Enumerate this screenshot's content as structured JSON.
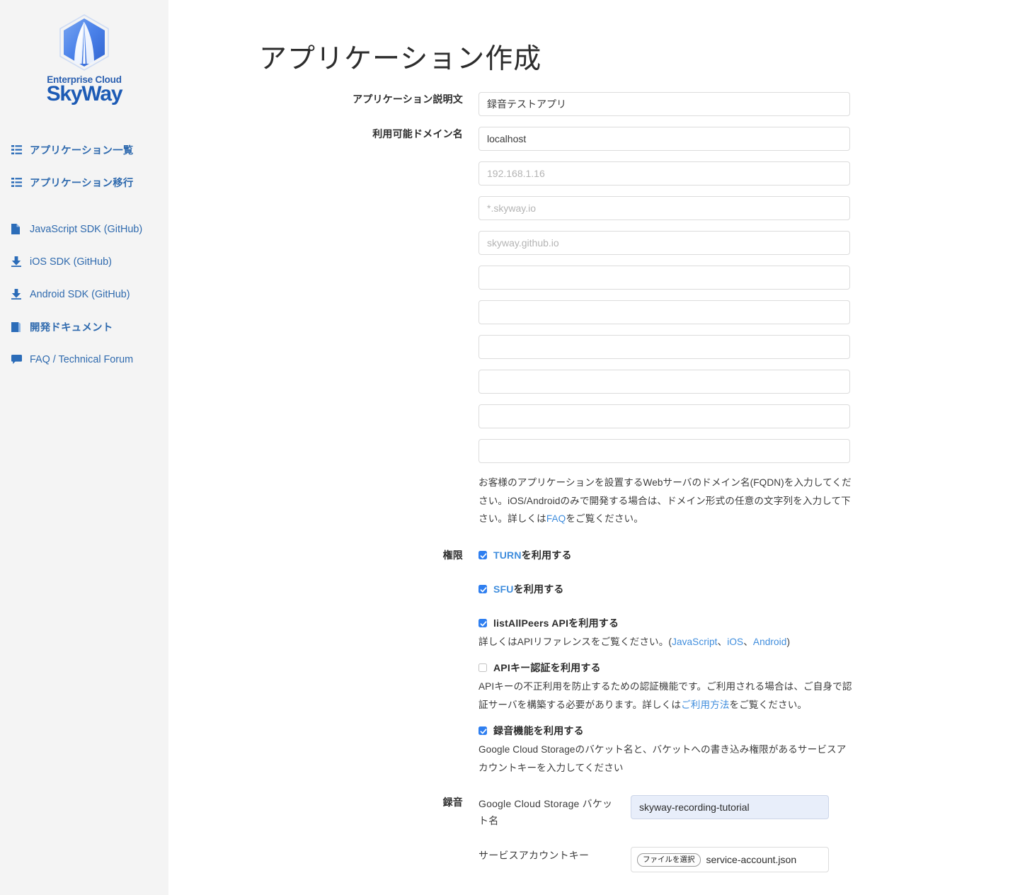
{
  "sidebar": {
    "logo": {
      "sub": "Enterprise Cloud",
      "main": "SkyWay",
      "icon": "skyway-hexagon-logo"
    },
    "nav": [
      {
        "label": "アプリケーション一覧",
        "icon": "list-icon"
      },
      {
        "label": "アプリケーション移行",
        "icon": "list-icon"
      },
      {
        "label": "JavaScript SDK (GitHub)",
        "icon": "file-icon"
      },
      {
        "label": "iOS SDK (GitHub)",
        "icon": "download-icon"
      },
      {
        "label": "Android SDK (GitHub)",
        "icon": "download-icon"
      },
      {
        "label": "開発ドキュメント",
        "icon": "book-icon"
      },
      {
        "label": "FAQ / Technical Forum",
        "icon": "comment-icon"
      }
    ]
  },
  "main": {
    "title": "アプリケーション作成",
    "fields": {
      "description": {
        "label": "アプリケーション説明文",
        "value": "録音テストアプリ"
      },
      "domains": {
        "label": "利用可能ドメイン名",
        "value": "localhost",
        "placeholders": [
          "192.168.1.16",
          "*.skyway.io",
          "skyway.github.io"
        ],
        "empty_count": 6,
        "help_1": "お客様のアプリケーションを設置するWebサーバのドメイン名(FQDN)を入力してください。iOS/Androidのみで開発する場合は、ドメイン形式の任意の文字列を入力して下さい。詳しくは",
        "help_link": "FAQ",
        "help_2": "をご覧ください。"
      },
      "permissions": {
        "label": "権限",
        "turn": {
          "link": "TURN",
          "rest": "を利用する",
          "checked": true
        },
        "sfu": {
          "link": "SFU",
          "rest": "を利用する",
          "checked": true
        },
        "listallpeers": {
          "text": "listAllPeers APIを利用する",
          "checked": true
        },
        "listallpeers_note_1": "詳しくはAPIリファレンスをご覧ください。(",
        "listallpeers_links": [
          "JavaScript",
          "iOS",
          "Android"
        ],
        "listallpeers_sep": "、",
        "listallpeers_note_2": ")",
        "apikey": {
          "text": "APIキー認証を利用する",
          "checked": false
        },
        "apikey_note_1": "APIキーの不正利用を防止するための認証機能です。ご利用される場合は、ご自身で認証サーバを構築する必要があります。詳しくは",
        "apikey_note_link": "ご利用方法",
        "apikey_note_2": "をご覧ください。",
        "recording": {
          "text": "録音機能を利用する",
          "checked": true
        },
        "recording_note": "Google Cloud Storageのバケット名と、バケットへの書き込み権限があるサービスアカウントキーを入力してください"
      },
      "recording": {
        "label": "録音",
        "bucket_label": "Google Cloud Storage バケット名",
        "bucket_value": "skyway-recording-tutorial",
        "key_label": "サービスアカウントキー",
        "file_button": "ファイルを選択",
        "file_name": "service-account.json"
      }
    }
  },
  "colors": {
    "sidebar_bg": "#f4f4f4",
    "link": "#3f8ddd",
    "nav_link": "#2f6aae",
    "checkbox": "#2f7ff0",
    "autofill_bg": "#e8eefa"
  }
}
